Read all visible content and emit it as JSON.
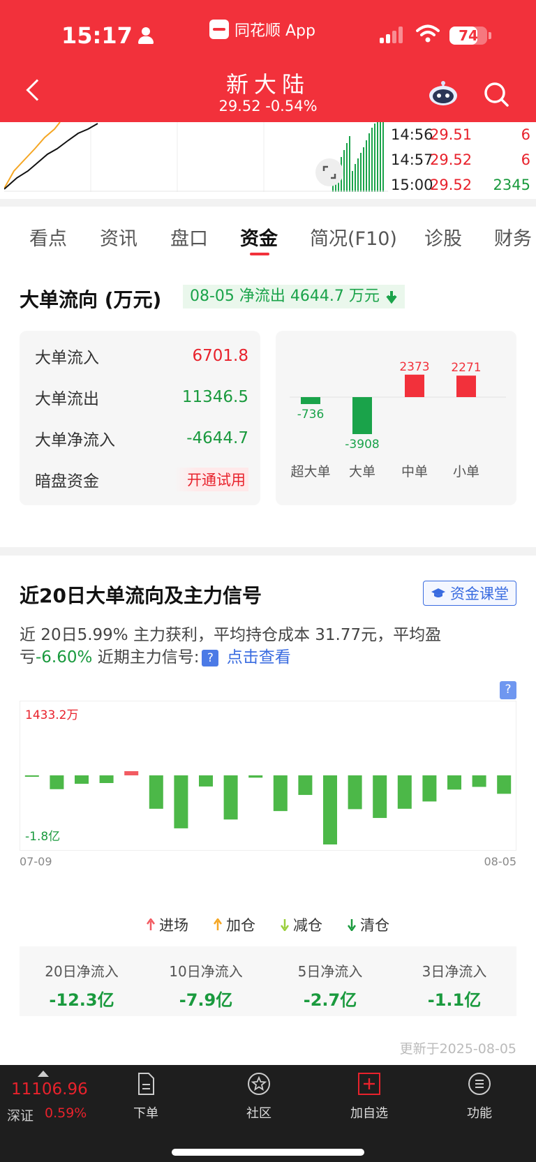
{
  "status_bar": {
    "time": "15:17",
    "app_label": "同花顺 App",
    "battery": "74",
    "battery_level": 0.74
  },
  "header": {
    "stock_name": "新大陆",
    "price_line": "29.52 -0.54%"
  },
  "ticks": [
    {
      "time": "14:56",
      "price": "29.51",
      "volume": "6",
      "dir": "up"
    },
    {
      "time": "14:57",
      "price": "29.52",
      "volume": "6",
      "dir": "up"
    },
    {
      "time": "15:00",
      "price": "29.52",
      "volume": "2345",
      "dir": "down"
    }
  ],
  "tabs": [
    "看点",
    "资讯",
    "盘口",
    "资金",
    "简况(F10)",
    "诊股",
    "财务"
  ],
  "active_tab": "资金",
  "big_order": {
    "title": "大单流向 (万元)",
    "badge": "08-05 净流出 4644.7 万元",
    "rows": [
      {
        "label": "大单流入",
        "value": "6701.8"
      },
      {
        "label": "大单流出",
        "value": "11346.5"
      },
      {
        "label": "大单净流入",
        "value": "-4644.7"
      },
      {
        "label": "暗盘资金",
        "value": "开通试用"
      }
    ]
  },
  "chart_data": [
    {
      "type": "bar",
      "categories": [
        "超大单",
        "大单",
        "中单",
        "小单"
      ],
      "values": [
        -736,
        -3908,
        2373,
        2271
      ]
    },
    {
      "type": "bar",
      "x_start_label": "07-09",
      "x_end_label": "08-05",
      "y_max_label": "1433.2万",
      "y_min_label": "-1.8亿",
      "values": [
        -100,
        -3600,
        -2200,
        -2000,
        1433,
        -8700,
        -13800,
        -2900,
        -11500,
        -600,
        -9300,
        -5100,
        -18000,
        -8800,
        -11100,
        -8700,
        -6800,
        -3700,
        -3000,
        -4800
      ],
      "ylim": [
        -18000,
        1433
      ]
    }
  ],
  "twenty_day": {
    "title": "近20日大单流向及主力信号",
    "course_btn": "资金课堂",
    "summary_1": "近 20日5.99% 主力获利，平均持仓成本 31.77元，平均盈亏",
    "summary_loss": "-6.60%",
    "summary_2": "近期主力信号:",
    "summary_link": "点击查看",
    "q_mark": "?",
    "legend": [
      "进场",
      "加仓",
      "减仓",
      "清仓"
    ],
    "stats": [
      {
        "label": "20日净流入",
        "value": "-12.3亿"
      },
      {
        "label": "10日净流入",
        "value": "-7.9亿"
      },
      {
        "label": "5日净流入",
        "value": "-2.7亿"
      },
      {
        "label": "3日净流入",
        "value": "-1.1亿"
      }
    ],
    "update_text": "更新于2025-08-05"
  },
  "bottom_bar": {
    "index_value": "11106.96",
    "index_name": "深证",
    "index_pct": "0.59%",
    "nav": [
      "下单",
      "社区",
      "加自选",
      "功能"
    ]
  },
  "colors": {
    "brand_red": "#f2313b",
    "up_red": "#e8222c",
    "down_green": "#1a9a3e",
    "link_blue": "#3a6ce0"
  }
}
